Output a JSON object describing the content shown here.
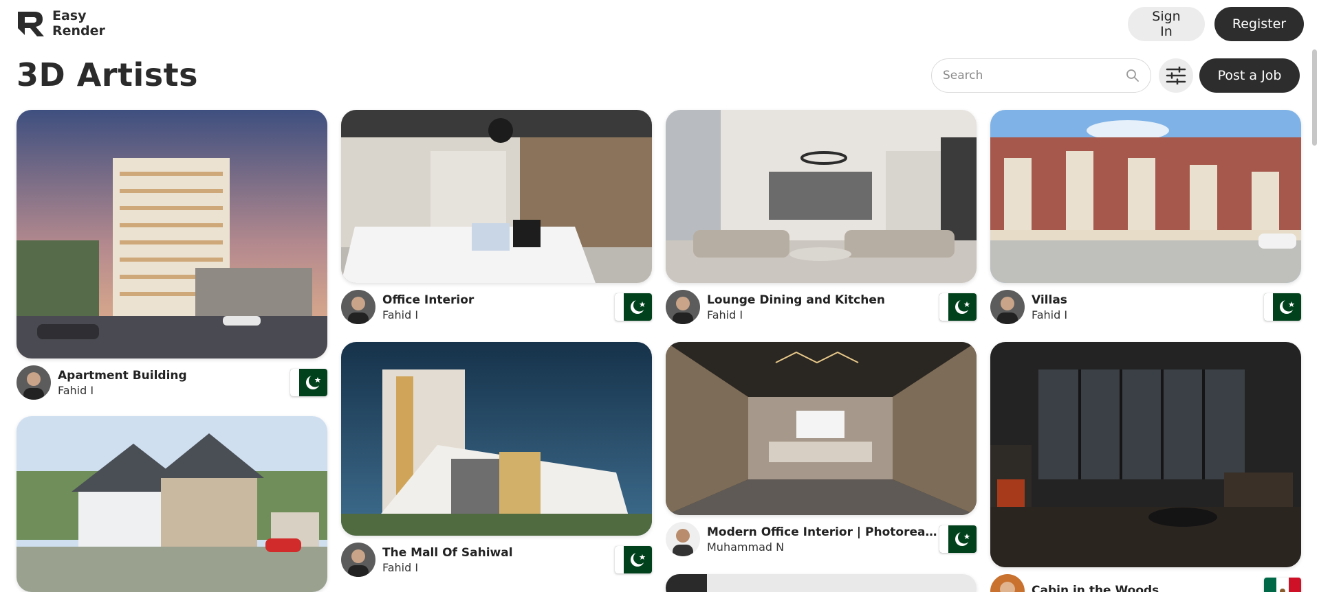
{
  "brand": {
    "line1": "Easy",
    "line2": "Render"
  },
  "header": {
    "sign_in": "Sign In",
    "register": "Register"
  },
  "page": {
    "title": "3D Artists"
  },
  "toolbar": {
    "search_placeholder": "Search",
    "post_job": "Post a Job"
  },
  "colors": {
    "dark_button": "#2d2d2d",
    "light_button": "#ececec",
    "pakistan_green": "#01411c"
  },
  "cards": [
    {
      "title": "Apartment Building",
      "author": "Fahid I",
      "flag": "pakistan-flag"
    },
    {
      "title": "",
      "author": "",
      "flag": ""
    },
    {
      "title": "Office Interior",
      "author": "Fahid I",
      "flag": "pakistan-flag"
    },
    {
      "title": "The Mall Of Sahiwal",
      "author": "Fahid I",
      "flag": "pakistan-flag"
    },
    {
      "title": "Lounge Dining and Kitchen",
      "author": "Fahid I",
      "flag": "pakistan-flag"
    },
    {
      "title": "Modern Office Interior | Photorealistic",
      "author": "Muhammad N",
      "flag": "pakistan-flag"
    },
    {
      "title": "Villas",
      "author": "Fahid I",
      "flag": "pakistan-flag"
    },
    {
      "title": "Cabin in the Woods",
      "author": "",
      "flag": "mexico-flag"
    }
  ]
}
